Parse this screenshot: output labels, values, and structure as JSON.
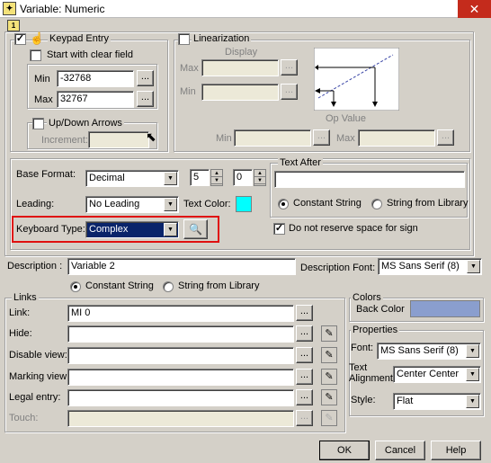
{
  "window": {
    "title": "Variable: Numeric",
    "close_glyph": "✕",
    "tab_number": "1"
  },
  "keypad": {
    "label": "Keypad Entry",
    "checked_mark": "✓",
    "start_clear": "Start with clear field",
    "min_label": "Min",
    "min_value": "-32768",
    "max_label": "Max",
    "max_value": "32767",
    "updown_label": "Up/Down Arrows",
    "increment_label": "Increment:"
  },
  "linearization": {
    "label": "Linearization",
    "display_label": "Display",
    "max_label": "Max",
    "min_label": "Min",
    "op_value_label": "Op Value",
    "op_min_label": "Min",
    "op_max_label": "Max"
  },
  "format": {
    "base_label": "Base Format:",
    "base_value": "Decimal",
    "digits": "5",
    "decimals": "0",
    "leading_label": "Leading:",
    "leading_value": "No Leading",
    "text_color_label": "Text Color:",
    "text_color": "#00ffff",
    "keyboard_label": "Keyboard Type:",
    "keyboard_value": "Complex"
  },
  "text_after": {
    "label": "Text After",
    "value": "",
    "constant": "Constant String",
    "library": "String from Library",
    "reserve_label": "Do not reserve space for sign",
    "reserve_check": "✓"
  },
  "description": {
    "label": "Description :",
    "value": "Variable 2",
    "font_label": "Description Font:",
    "font_value": "MS Sans Serif (8)",
    "constant": "Constant String",
    "library": "String from Library"
  },
  "links": {
    "label": "Links",
    "rows": [
      {
        "label": "Link:",
        "value": "MI 0"
      },
      {
        "label": "Hide:",
        "value": ""
      },
      {
        "label": "Disable view:",
        "value": ""
      },
      {
        "label": "Marking view:",
        "value": ""
      },
      {
        "label": "Legal entry:",
        "value": ""
      },
      {
        "label": "Touch:",
        "value": ""
      }
    ]
  },
  "colors": {
    "label": "Colors",
    "back_label": "Back Color",
    "back_color": "#8a9ece"
  },
  "properties": {
    "label": "Properties",
    "font_label": "Font:",
    "font_value": "MS Sans Serif (8)",
    "align_label": "Text Alignment",
    "align_value": "Center Center",
    "style_label": "Style:",
    "style_value": "Flat"
  },
  "buttons": {
    "ok": "OK",
    "cancel": "Cancel",
    "help": "Help",
    "dots": "...",
    "dropdown_glyph": "▼",
    "spin_up": "▲",
    "spin_down": "▼",
    "pencil_glyph": "✎",
    "magnifier_glyph": "🔍"
  }
}
